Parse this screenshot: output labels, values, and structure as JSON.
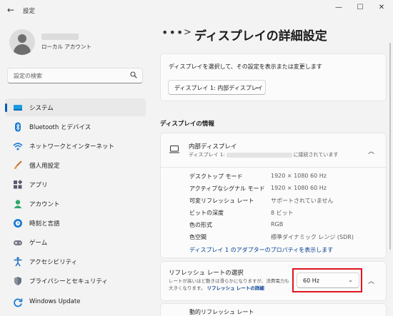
{
  "window": {
    "title": "設定",
    "minimize": "—",
    "maximize": "☐",
    "close": "✕"
  },
  "user": {
    "account_type": "ローカル アカウント"
  },
  "search": {
    "placeholder": "設定の検索"
  },
  "sidebar": {
    "items": [
      {
        "label": "システム",
        "icon": "system-icon",
        "active": true
      },
      {
        "label": "Bluetooth とデバイス",
        "icon": "bluetooth-icon"
      },
      {
        "label": "ネットワークとインターネット",
        "icon": "wifi-icon"
      },
      {
        "label": "個人用設定",
        "icon": "brush-icon"
      },
      {
        "label": "アプリ",
        "icon": "apps-icon"
      },
      {
        "label": "アカウント",
        "icon": "account-icon"
      },
      {
        "label": "時刻と言語",
        "icon": "globe-icon"
      },
      {
        "label": "ゲーム",
        "icon": "gamepad-icon"
      },
      {
        "label": "アクセシビリティ",
        "icon": "accessibility-icon"
      },
      {
        "label": "プライバシーとセキュリティ",
        "icon": "shield-icon"
      },
      {
        "label": "Windows Update",
        "icon": "update-icon"
      }
    ]
  },
  "breadcrumb": {
    "ellipsis": "•••",
    "separator": ">",
    "title": "ディスプレイの詳細設定"
  },
  "select_display": {
    "description": "ディスプレイを選択して、その設定を表示または変更します",
    "selected": "ディスプレイ 1: 内部ディスプレイ"
  },
  "display_info": {
    "heading": "ディスプレイの情報",
    "name": "内部ディスプレイ",
    "connected_prefix": "ディスプレイ 1:",
    "connected_suffix": "に接続されています",
    "properties": [
      {
        "key": "デスクトップ モード",
        "value": "1920 × 1080 60 Hz"
      },
      {
        "key": "アクティブなシグナル モード",
        "value": "1920 × 1080 60 Hz"
      },
      {
        "key": "可変リフレッシュ レート",
        "value": "サポートされていません"
      },
      {
        "key": "ビットの深度",
        "value": "8 ビット"
      },
      {
        "key": "色の形式",
        "value": "RGB"
      },
      {
        "key": "色空間",
        "value": "標準ダイナミック レンジ (SDR)"
      }
    ],
    "adapter_link": "ディスプレイ 1 のアダプターのプロパティを表示します"
  },
  "refresh_rate": {
    "title": "リフレッシュ レートの選択",
    "description": "レートが高いほど動きは滑らかになりますが、消費電力も大きくなります。",
    "detail_link": "リフレッシュ レートの詳細",
    "selected": "60 Hz",
    "highlight_color": "#e0141e"
  },
  "dynamic_refresh": {
    "label": "動的リフレッシュ レート"
  },
  "colors": {
    "accent": "#005fb8",
    "link": "#003e92"
  }
}
